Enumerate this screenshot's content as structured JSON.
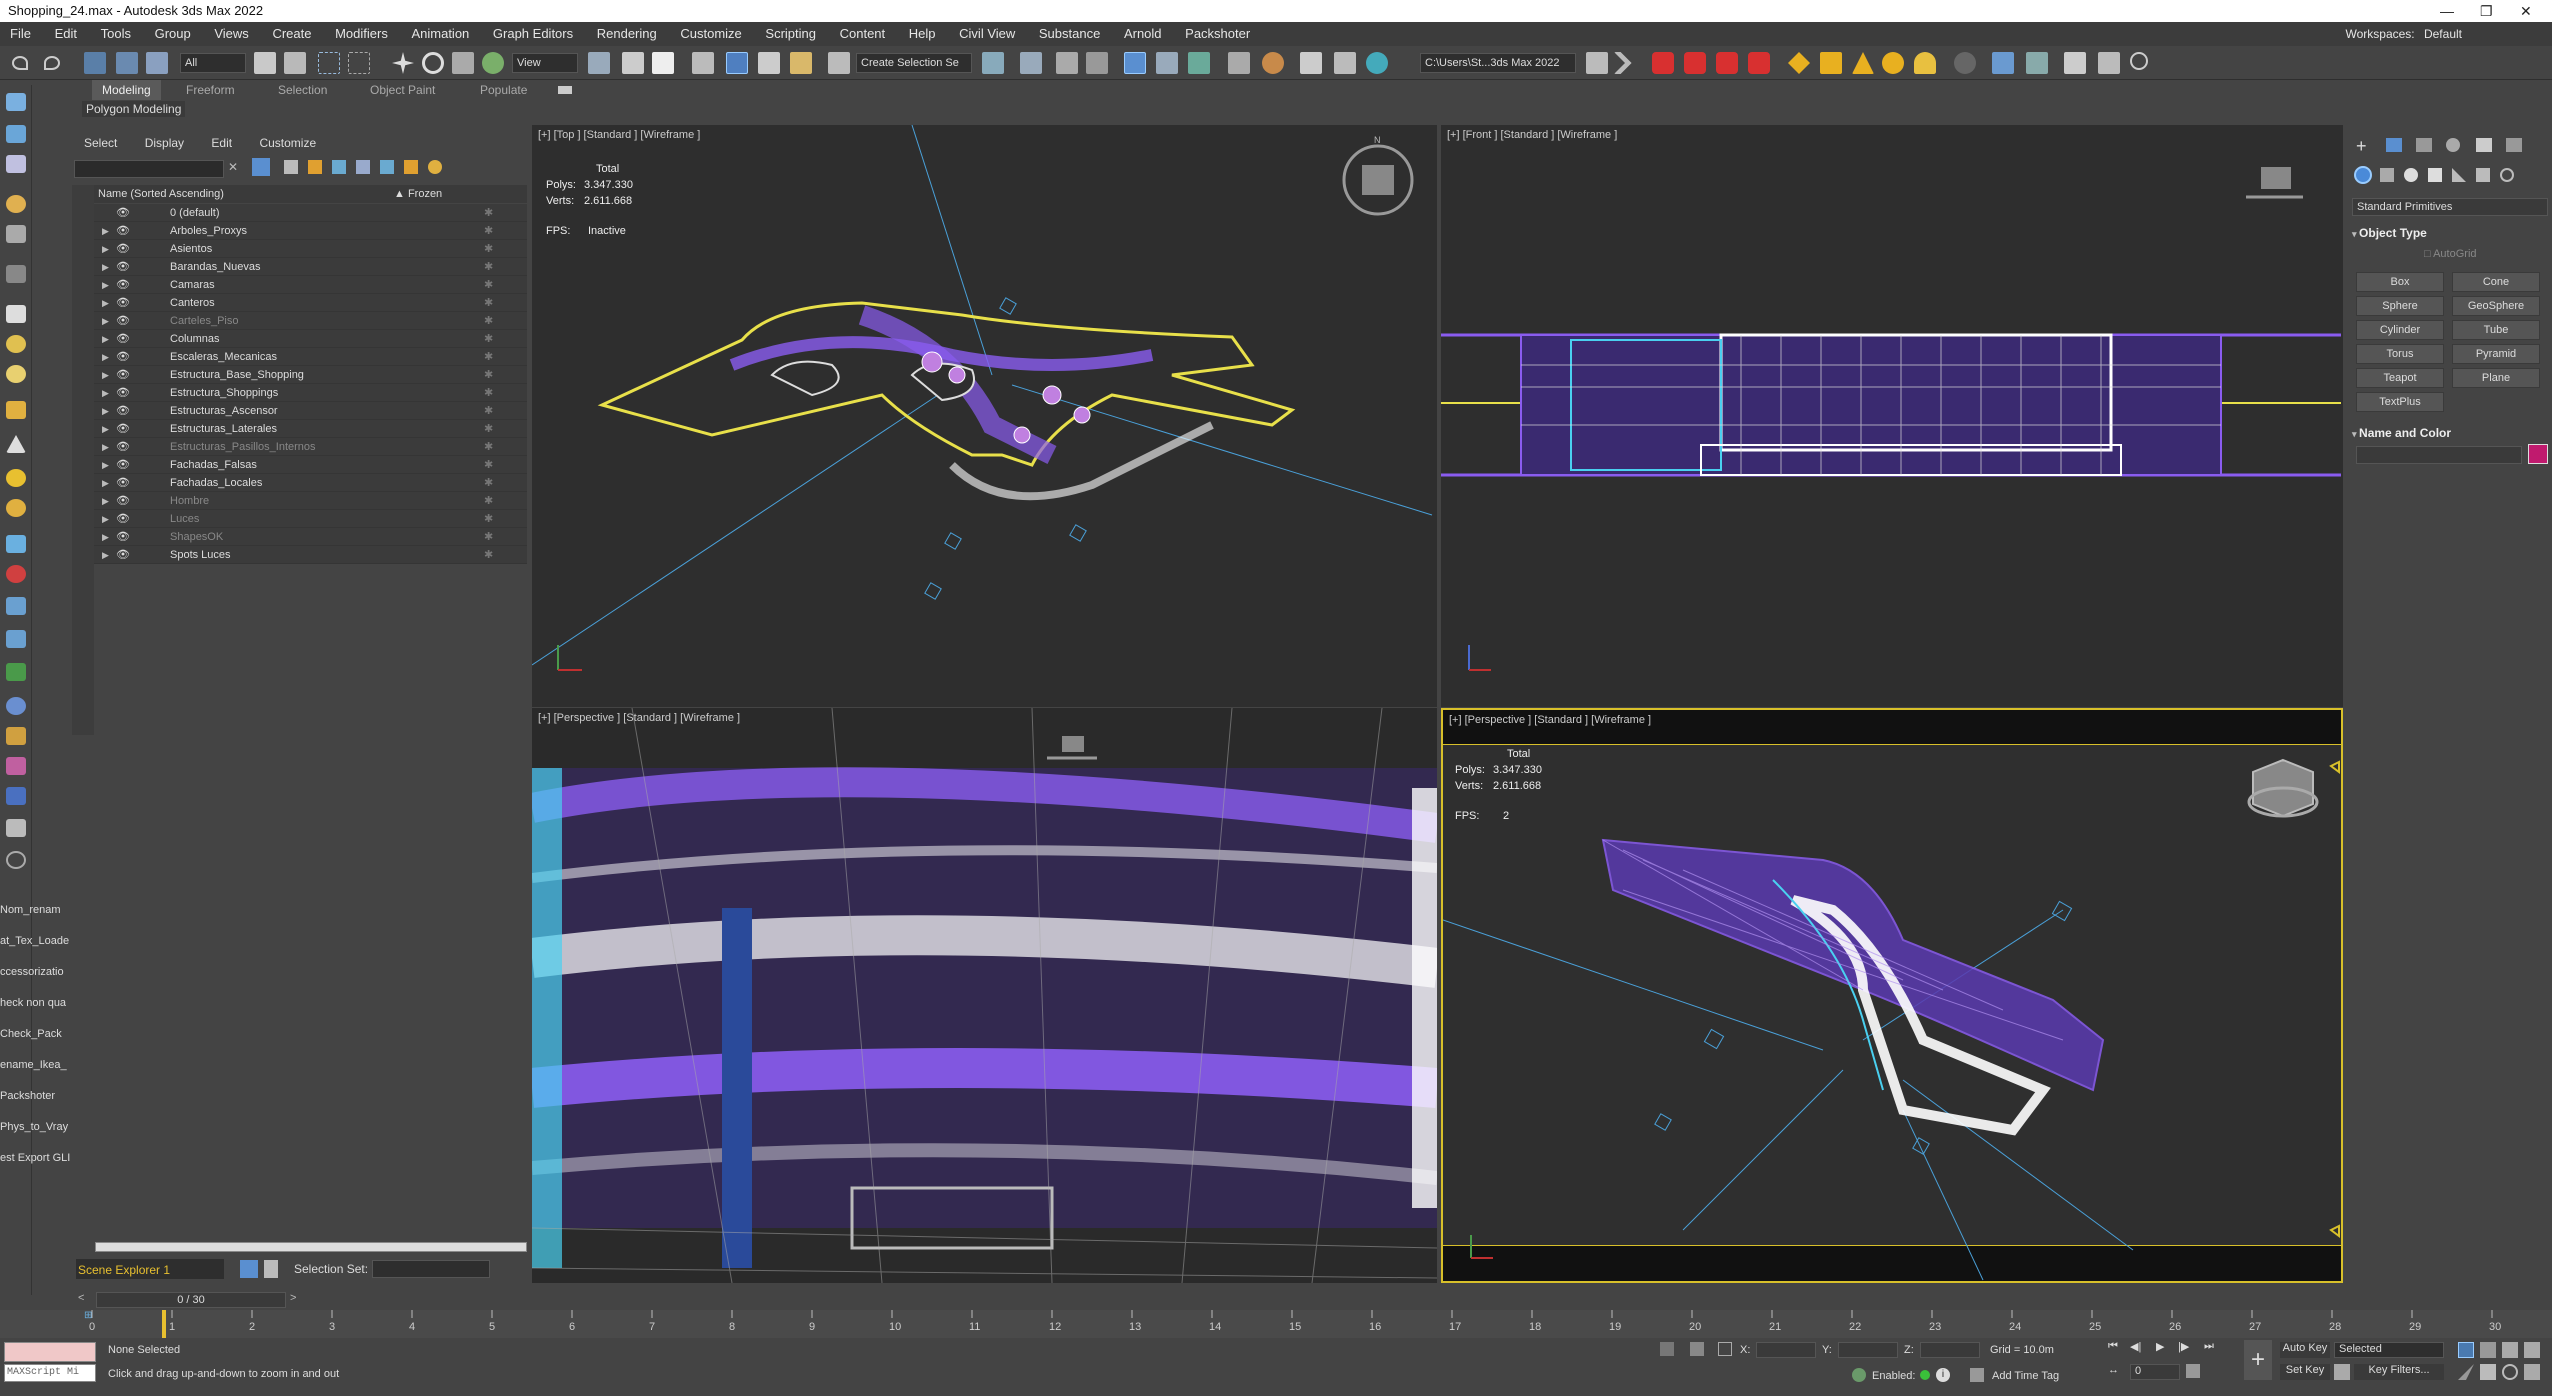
{
  "window": {
    "title": "Shopping_24.max - Autodesk 3ds Max 2022",
    "min": "—",
    "max": "❐",
    "close": "✕"
  },
  "menu": [
    "File",
    "Edit",
    "Tools",
    "Group",
    "Views",
    "Create",
    "Modifiers",
    "Animation",
    "Graph Editors",
    "Rendering",
    "Customize",
    "Scripting",
    "Content",
    "Help",
    "Civil View",
    "Substance",
    "Arnold",
    "Packshoter"
  ],
  "workspace": {
    "label": "Workspaces:",
    "value": "Default"
  },
  "toolbar": {
    "filter": "All",
    "refcoord": "View",
    "selset": "Create Selection Se",
    "path": "C:\\Users\\St...3ds Max 2022"
  },
  "ribbon": {
    "tabs": [
      "Modeling",
      "Freeform",
      "Selection",
      "Object Paint",
      "Populate"
    ],
    "sub": "Polygon Modeling"
  },
  "scripts": [
    "Nom_renam",
    "at_Tex_Loade",
    "ccessorizatio",
    "heck non qua",
    "Check_Pack",
    "ename_Ikea_",
    "Packshoter",
    "Phys_to_Vray",
    "est Export GLI"
  ],
  "explorer": {
    "menu": [
      "Select",
      "Display",
      "Edit",
      "Customize"
    ],
    "col_name": "Name (Sorted Ascending)",
    "col_frozen": "▲ Frozen",
    "rows": [
      {
        "name": "0 (default)",
        "dim": false
      },
      {
        "name": "Arboles_Proxys",
        "dim": false
      },
      {
        "name": "Asientos",
        "dim": false
      },
      {
        "name": "Barandas_Nuevas",
        "dim": false
      },
      {
        "name": "Camaras",
        "dim": false
      },
      {
        "name": "Canteros",
        "dim": false
      },
      {
        "name": "Carteles_Piso",
        "dim": true
      },
      {
        "name": "Columnas",
        "dim": false
      },
      {
        "name": "Escaleras_Mecanicas",
        "dim": false
      },
      {
        "name": "Estructura_Base_Shopping",
        "dim": false
      },
      {
        "name": "Estructura_Shoppings",
        "dim": false
      },
      {
        "name": "Estructuras_Ascensor",
        "dim": false
      },
      {
        "name": "Estructuras_Laterales",
        "dim": false
      },
      {
        "name": "Estructuras_Pasillos_Internos",
        "dim": true
      },
      {
        "name": "Fachadas_Falsas",
        "dim": false
      },
      {
        "name": "Fachadas_Locales",
        "dim": false
      },
      {
        "name": "Hombre",
        "dim": true
      },
      {
        "name": "Luces",
        "dim": true
      },
      {
        "name": "ShapesOK",
        "dim": true
      },
      {
        "name": "Spots Luces",
        "dim": false
      }
    ],
    "footer": "Scene Explorer 1",
    "selset_label": "Selection Set:"
  },
  "viewports": {
    "top": {
      "label": "[+] [Top ] [Standard ] [Wireframe ]",
      "total": "Total",
      "polys_l": "Polys:",
      "polys": "3.347.330",
      "verts_l": "Verts:",
      "verts": "2.611.668",
      "fps_l": "FPS:",
      "fps": "Inactive"
    },
    "front": {
      "label": "[+] [Front ] [Standard ] [Wireframe ]"
    },
    "persp1": {
      "label": "[+] [Perspective ] [Standard ] [Wireframe ]"
    },
    "persp2": {
      "label": "[+] [Perspective ] [Standard ] [Wireframe ]",
      "total": "Total",
      "polys_l": "Polys:",
      "polys": "3.347.330",
      "verts_l": "Verts:",
      "verts": "2.611.668",
      "fps_l": "FPS:",
      "fps": "2"
    }
  },
  "command": {
    "dropdown": "Standard Primitives",
    "object_type": "Object Type",
    "autogrid": "AutoGrid",
    "buttons": [
      "Box",
      "Cone",
      "Sphere",
      "GeoSphere",
      "Cylinder",
      "Tube",
      "Torus",
      "Pyramid",
      "Teapot",
      "Plane",
      "TextPlus"
    ],
    "name_color": "Name and Color",
    "swatch": "#c01a6e"
  },
  "timeline": {
    "frame": "0 / 30",
    "ticks": [
      "0",
      "1",
      "2",
      "3",
      "4",
      "5",
      "6",
      "7",
      "8",
      "9",
      "10",
      "11",
      "12",
      "13",
      "14",
      "15",
      "16",
      "17",
      "18",
      "19",
      "20",
      "21",
      "22",
      "23",
      "24",
      "25",
      "26",
      "27",
      "28",
      "29",
      "30"
    ]
  },
  "status": {
    "maxscript": "MAXScript Mi",
    "selected": "None Selected",
    "prompt": "Click and drag up-and-down to zoom in and out",
    "x": "X:",
    "y": "Y:",
    "z": "Z:",
    "grid": "Grid = 10.0m",
    "enabled": "Enabled:",
    "add_time_tag": "Add Time Tag",
    "auto_key": "Auto Key",
    "selected_dd": "Selected",
    "set_key": "Set Key",
    "key_filters": "Key Filters...",
    "frame_field": "0"
  },
  "colors": {
    "wire_purple": "#8a5cf0",
    "wire_yellow": "#e8e04a",
    "viewport_bg": "#2e2e2e",
    "active_border": "#d8c02a"
  }
}
